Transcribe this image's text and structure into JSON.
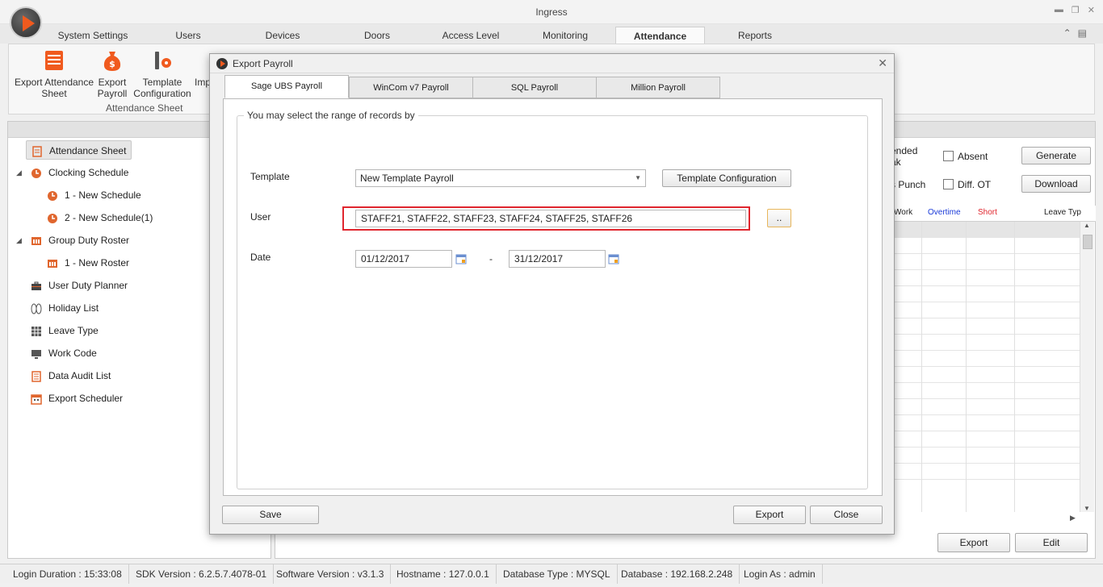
{
  "app": {
    "title": "Ingress"
  },
  "window_controls": [
    "minimize-icon",
    "restore-icon",
    "close-icon"
  ],
  "main_tabs": [
    {
      "label": "System Settings"
    },
    {
      "label": "Users"
    },
    {
      "label": "Devices"
    },
    {
      "label": "Doors"
    },
    {
      "label": "Access Level"
    },
    {
      "label": "Monitoring"
    },
    {
      "label": "Attendance",
      "active": true
    },
    {
      "label": "Reports"
    }
  ],
  "ribbon": {
    "buttons": [
      {
        "label": "Export Attendance Sheet",
        "icon": "attendance-sheet-icon"
      },
      {
        "label": "Export Payroll",
        "icon": "money-bag-icon"
      },
      {
        "label": "Template Configuration",
        "icon": "tools-gear-icon"
      },
      {
        "label": "Imp",
        "icon": "import-icon"
      }
    ],
    "group_label": "Attendance Sheet"
  },
  "tree": [
    {
      "label": "Attendance Sheet",
      "icon": "clipboard-icon",
      "selected": true
    },
    {
      "label": "Clocking Schedule",
      "icon": "clock-icon",
      "expanded": true
    },
    {
      "label": "1 - New Schedule",
      "icon": "clock-icon"
    },
    {
      "label": "2 - New Schedule(1)",
      "icon": "clock-icon"
    },
    {
      "label": "Group Duty Roster",
      "icon": "roster-icon",
      "expanded": true
    },
    {
      "label": "1 - New Roster",
      "icon": "roster-icon"
    },
    {
      "label": "User Duty Planner",
      "icon": "briefcase-icon"
    },
    {
      "label": "Holiday List",
      "icon": "flipflop-icon"
    },
    {
      "label": "Leave Type",
      "icon": "grid-icon"
    },
    {
      "label": "Work Code",
      "icon": "monitor-icon"
    },
    {
      "label": "Data Audit List",
      "icon": "list-icon"
    },
    {
      "label": "Export Scheduler",
      "icon": "calendar-icon"
    }
  ],
  "right_panel": {
    "opt_extended": "ended",
    "opt_break": "ak",
    "opt_punch": "s Punch",
    "absent_label": "Absent",
    "diff_ot_label": "Diff. OT",
    "generate_label": "Generate",
    "download_label": "Download",
    "grid_headers": [
      {
        "label": "Work",
        "color": "#222222"
      },
      {
        "label": "Overtime",
        "color": "#1a3ad8"
      },
      {
        "label": "Short",
        "color": "#e0262e"
      },
      {
        "label": "Leave Typ",
        "color": "#222222"
      }
    ],
    "export_label": "Export",
    "edit_label": "Edit"
  },
  "dialog": {
    "title": "Export Payroll",
    "tabs": [
      {
        "label": "Sage UBS Payroll",
        "active": true
      },
      {
        "label": "WinCom v7 Payroll"
      },
      {
        "label": "SQL Payroll"
      },
      {
        "label": "Million Payroll"
      }
    ],
    "group_title": "You may select the range of records by",
    "template_label": "Template",
    "template_value": "New Template Payroll",
    "template_config_label": "Template Configuration",
    "user_label": "User",
    "user_value": "STAFF21, STAFF22, STAFF23, STAFF24, STAFF25, STAFF26",
    "browse_label": "..",
    "date_label": "Date",
    "date_from": "01/12/2017",
    "date_separator": "-",
    "date_to": "31/12/2017",
    "save_label": "Save",
    "export_label": "Export",
    "close_label": "Close"
  },
  "status_bar": [
    "Login Duration : 15:33:08",
    "SDK Version : 6.2.5.7.4078-01",
    "Software Version : v3.1.3",
    "Hostname : 127.0.0.1",
    "Database Type : MYSQL",
    "Database : 192.168.2.248",
    "Login As : admin"
  ],
  "colors": {
    "accent": "#f05a1e",
    "highlight": "#e0262e",
    "overtime": "#1a3ad8"
  }
}
